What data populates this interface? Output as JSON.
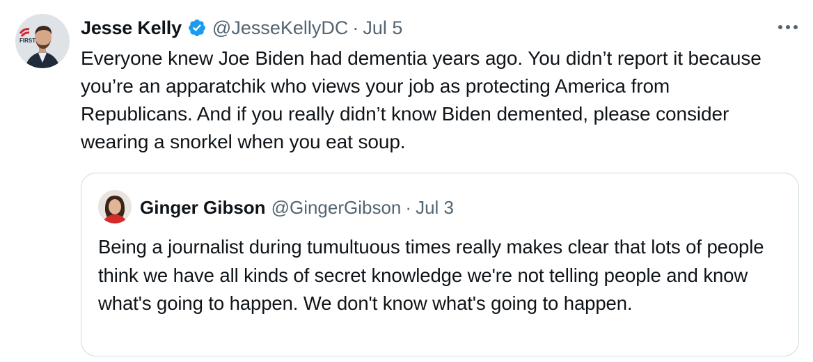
{
  "tweet": {
    "author_name": "Jesse Kelly",
    "handle": "@JesseKellyDC",
    "separator": "·",
    "date": "Jul 5",
    "verified_color": "#1d9bf0",
    "more_icon": "more-horizontal-icon",
    "text": "Everyone knew Joe Biden had dementia years ago. You didn’t report it because you’re an apparatchik who views your job as protecting America from Republicans. And if you really didn’t know Biden demented, please consider wearing a snorkel when you eat soup.",
    "avatar_badge": "FIRST"
  },
  "quoted_tweet": {
    "author_name": "Ginger Gibson",
    "handle": "@GingerGibson",
    "separator": "·",
    "date": "Jul 3",
    "text": "Being a journalist during tumultuous times really makes clear that lots of people think we have all kinds of secret knowledge we're not telling people and know what's going to happen. We don't know what's going to happen."
  },
  "colors": {
    "text_primary": "#0f1419",
    "text_secondary": "#536471",
    "border": "#cfd9de",
    "accent": "#1d9bf0"
  }
}
